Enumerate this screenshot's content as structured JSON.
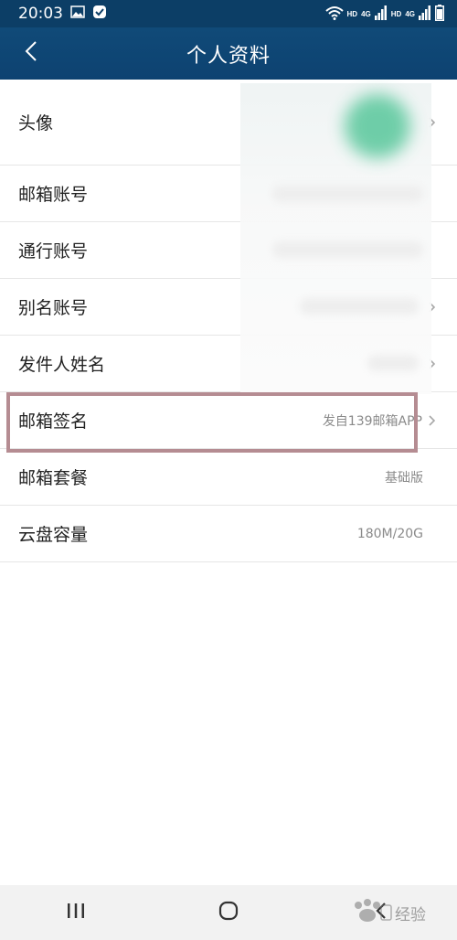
{
  "status_bar": {
    "time": "20:03",
    "hd1": "HD",
    "hd2": "HD",
    "network1": "4G",
    "network2": "4G",
    "icons": [
      "image-icon",
      "notification-icon",
      "wifi-icon",
      "signal-icon",
      "battery-icon"
    ]
  },
  "nav": {
    "title": "个人资料",
    "back_icon": "chevron-left-icon"
  },
  "rows": [
    {
      "label": "头像",
      "value": "",
      "chevron": true
    },
    {
      "label": "邮箱账号",
      "value": "",
      "chevron": false
    },
    {
      "label": "通行账号",
      "value": "",
      "chevron": false
    },
    {
      "label": "别名账号",
      "value": "",
      "chevron": true
    },
    {
      "label": "发件人姓名",
      "value": "",
      "chevron": true
    },
    {
      "label": "邮箱签名",
      "value": "发自139邮箱APP",
      "chevron": true
    },
    {
      "label": "邮箱套餐",
      "value": "基础版",
      "chevron": false
    },
    {
      "label": "云盘容量",
      "value": "180M/20G",
      "chevron": false
    }
  ],
  "colors": {
    "header": "#0d4271",
    "highlight": "#b58c92"
  },
  "bottom_nav": {
    "icons": [
      "recent-apps-icon",
      "home-icon",
      "back-icon"
    ]
  },
  "watermark": {
    "text": "经验"
  }
}
